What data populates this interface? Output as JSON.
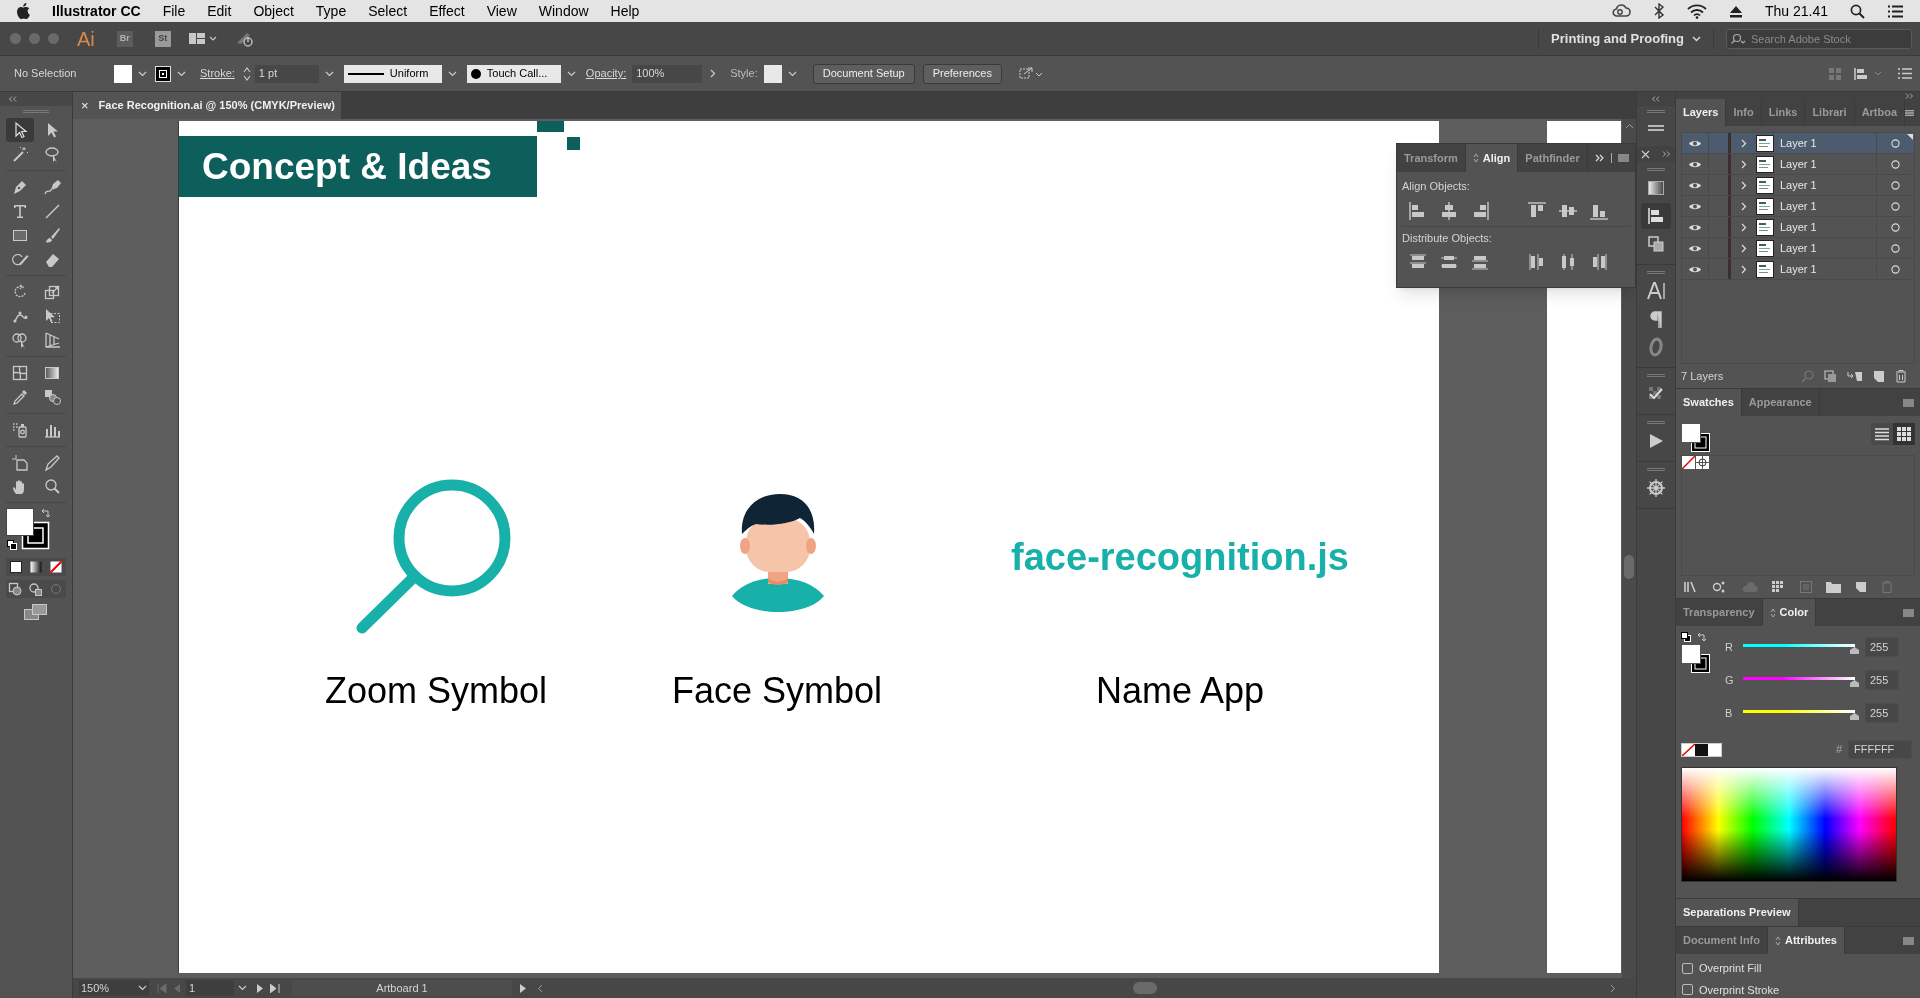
{
  "menu_bar": {
    "app_name": "Illustrator CC",
    "menus": [
      "File",
      "Edit",
      "Object",
      "Type",
      "Select",
      "Effect",
      "View",
      "Window",
      "Help"
    ],
    "clock": "Thu 21.41"
  },
  "app_bar": {
    "app_icons": [
      "Ai",
      "Br",
      "St"
    ],
    "workspace": "Printing and Proofing",
    "search": {
      "placeholder": "Search Adobe Stock"
    }
  },
  "control_bar": {
    "selection": "No Selection",
    "stroke_label": "Stroke:",
    "stroke_weight": "1 pt",
    "profile": "Uniform",
    "brush": "Touch Call...",
    "opacity_label": "Opacity:",
    "opacity": "100%",
    "style_label": "Style:",
    "buttons": [
      "Document Setup",
      "Preferences"
    ]
  },
  "document_tab": {
    "close": "×",
    "title": "Face Recognition.ai @ 150% (CMYK/Preview)"
  },
  "artboard": {
    "heading": "Concept & Ideas",
    "items": [
      {
        "kind": "magnifier",
        "label": "Zoom Symbol"
      },
      {
        "kind": "face",
        "label": "Face Symbol"
      },
      {
        "kind": "wordmark",
        "text": "face-recognition.js",
        "label": "Name App"
      }
    ]
  },
  "align_panel": {
    "tabs": [
      {
        "label": "Transform",
        "selected": false
      },
      {
        "label": "Align",
        "selected": true
      },
      {
        "label": "Pathfinder",
        "selected": false
      }
    ],
    "sections": [
      "Align Objects:",
      "Distribute Objects:"
    ]
  },
  "layers_panel": {
    "tabs": [
      {
        "label": "Layers",
        "selected": true
      },
      {
        "label": "Info",
        "selected": false
      },
      {
        "label": "Links",
        "selected": false
      },
      {
        "label": "Librari",
        "selected": false
      },
      {
        "label": "Artboa",
        "selected": false
      }
    ],
    "layers": [
      {
        "name": "Layer 1",
        "selected": true
      },
      {
        "name": "Layer 1",
        "selected": false
      },
      {
        "name": "Layer 1",
        "selected": false
      },
      {
        "name": "Layer 1",
        "selected": false
      },
      {
        "name": "Layer 1",
        "selected": false
      },
      {
        "name": "Layer 1",
        "selected": false
      },
      {
        "name": "Layer 1",
        "selected": false
      }
    ],
    "count": "7 Layers"
  },
  "swatches_panel": {
    "tabs": [
      {
        "label": "Swatches",
        "selected": true
      },
      {
        "label": "Appearance",
        "selected": false
      }
    ]
  },
  "color_panel": {
    "tabs": [
      {
        "label": "Transparency",
        "selected": false
      },
      {
        "label": "Color",
        "selected": true
      }
    ],
    "channels": [
      {
        "name": "R",
        "value": "255",
        "level": 1,
        "color": "#00ffff"
      },
      {
        "name": "G",
        "value": "255",
        "level": 1,
        "color": "#ff00ff"
      },
      {
        "name": "B",
        "value": "255",
        "level": 1,
        "color": "#ffff00"
      }
    ],
    "hex_label": "#",
    "hex": "FFFFFF"
  },
  "separations_panel": {
    "tabs": [
      {
        "label": "Separations Preview",
        "selected": true
      }
    ]
  },
  "attributes_panel": {
    "tabs": [
      {
        "label": "Document Info",
        "selected": false
      },
      {
        "label": "Attributes",
        "selected": true
      }
    ],
    "options": [
      {
        "label": "Overprint Fill",
        "checked": false
      },
      {
        "label": "Overprint Stroke",
        "checked": false
      }
    ]
  },
  "status_bar": {
    "zoom": "150%",
    "artboard_number": "1",
    "artboard_name": "Artboard 1"
  }
}
